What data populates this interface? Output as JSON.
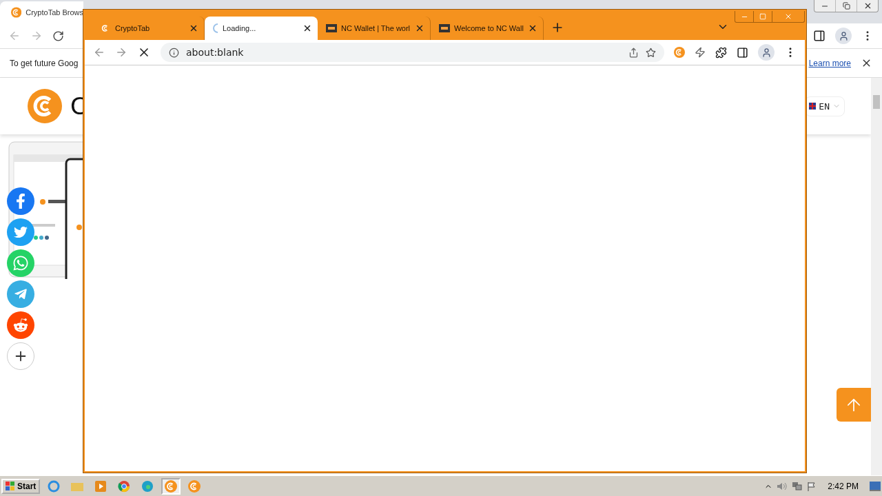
{
  "background_browser": {
    "tab": {
      "title": "CryptoTab Brows"
    },
    "infobar": {
      "message": "To get future Goog",
      "link": "Learn more"
    },
    "site": {
      "logo_text": "C",
      "language": "EN"
    }
  },
  "popup_window": {
    "tabs": [
      {
        "title": "CryptoTab",
        "selected": false,
        "kind": "cryptotab"
      },
      {
        "title": "Loading...",
        "selected": true,
        "kind": "spinner"
      },
      {
        "title": "NC Wallet | The worl",
        "selected": false,
        "kind": "wallet"
      },
      {
        "title": "Welcome to NC Wall",
        "selected": false,
        "kind": "wallet"
      }
    ],
    "address": "about:blank"
  },
  "taskbar": {
    "start": "Start",
    "clock": "2:42 PM"
  }
}
